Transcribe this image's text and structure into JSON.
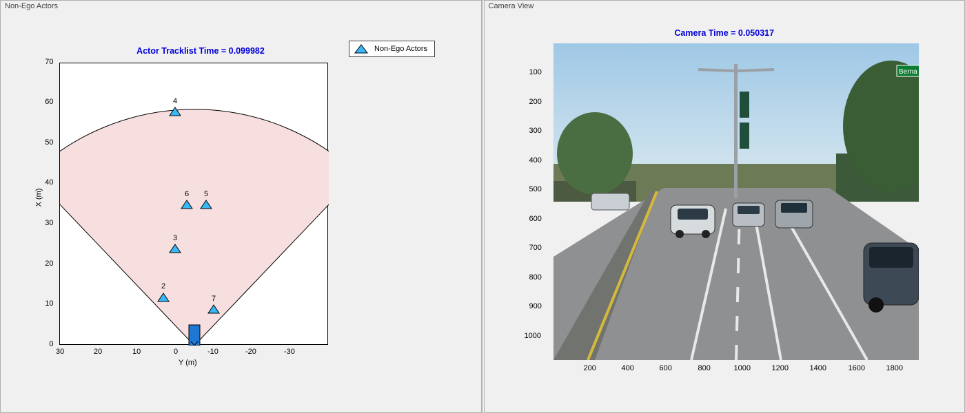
{
  "left": {
    "panel_title": "Non-Ego Actors",
    "chart_title": "Actor Tracklist Time = 0.099982",
    "legend_label": "Non-Ego Actors",
    "x_axis_label": "Y (m)",
    "y_axis_label": "X (m)",
    "x_ticks": [
      "30",
      "20",
      "10",
      "0",
      "-10",
      "-20",
      "-30"
    ],
    "y_ticks": [
      "0",
      "10",
      "20",
      "30",
      "40",
      "50",
      "60",
      "70"
    ],
    "actors_labels": [
      "2",
      "3",
      "4",
      "5",
      "6",
      "7"
    ]
  },
  "right": {
    "panel_title": "Camera View",
    "chart_title": "Camera Time = 0.050317",
    "x_ticks": [
      "200",
      "400",
      "600",
      "800",
      "1000",
      "1200",
      "1400",
      "1600",
      "1800"
    ],
    "y_ticks": [
      "100",
      "200",
      "300",
      "400",
      "500",
      "600",
      "700",
      "800",
      "900",
      "1000"
    ]
  },
  "chart_data": [
    {
      "type": "scatter",
      "title": "Actor Tracklist Time = 0.099982",
      "xlabel": "Y (m)",
      "ylabel": "X (m)",
      "xlim": [
        35,
        -35
      ],
      "ylim": [
        0,
        70
      ],
      "sensor_fov": {
        "origin_x": 0,
        "origin_y": 0,
        "radius": 60,
        "half_angle_deg": 45
      },
      "ego_vehicle": {
        "x": 0,
        "y": 2
      },
      "series": [
        {
          "name": "Non-Ego Actors",
          "points": [
            {
              "id": 2,
              "y": 8,
              "x": 12
            },
            {
              "id": 3,
              "y": 5,
              "x": 24
            },
            {
              "id": 4,
              "y": 5,
              "x": 58
            },
            {
              "id": 5,
              "y": -3,
              "x": 35
            },
            {
              "id": 6,
              "y": 2,
              "x": 35
            },
            {
              "id": 7,
              "y": -5,
              "x": 9
            }
          ]
        }
      ],
      "legend": [
        "Non-Ego Actors"
      ]
    },
    {
      "type": "image",
      "title": "Camera Time = 0.050317",
      "xlim": [
        0,
        1920
      ],
      "ylim": [
        1080,
        0
      ],
      "x_ticks": [
        200,
        400,
        600,
        800,
        1000,
        1200,
        1400,
        1600,
        1800
      ],
      "y_ticks": [
        100,
        200,
        300,
        400,
        500,
        600,
        700,
        800,
        900,
        1000
      ],
      "description": "Forward-facing street camera frame: multi-lane road, several vehicles ahead, trees and street lights, daylight."
    }
  ]
}
